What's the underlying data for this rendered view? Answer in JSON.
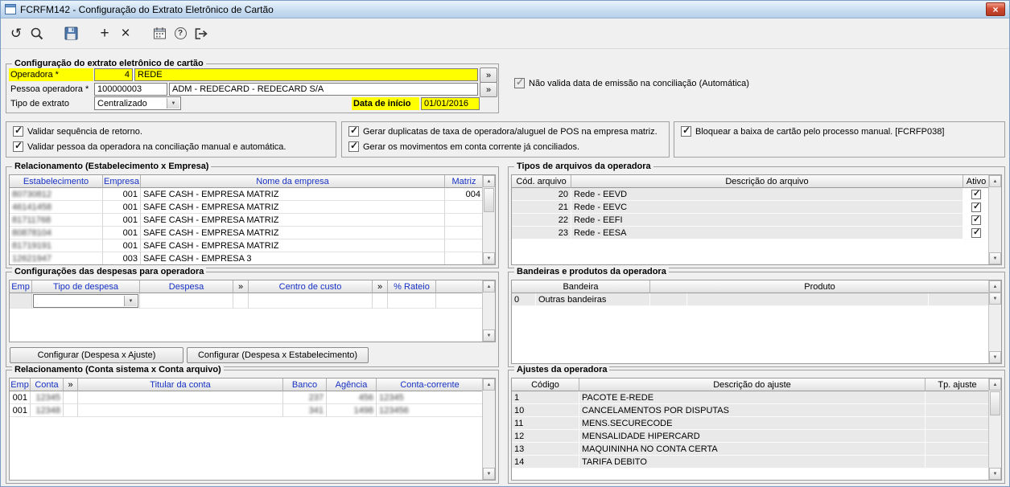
{
  "window": {
    "title": "FCRFM142 - Configuração do Extrato Eletrônico de Cartão",
    "close_label": "×"
  },
  "toolbar": {
    "icons": [
      "undo-icon",
      "search-icon",
      "save-icon",
      "add-icon",
      "delete-icon",
      "calendar-icon",
      "help-icon",
      "exit-icon"
    ]
  },
  "config": {
    "legend": "Configuração do extrato eletrônico de cartão",
    "operadora_label": "Operadora *",
    "operadora_code": "4",
    "operadora_name": "REDE",
    "pessoa_label": "Pessoa operadora *",
    "pessoa_code": "100000003",
    "pessoa_name": "ADM - REDECARD - REDECARD S/A",
    "tipo_label": "Tipo de extrato",
    "tipo_value": "Centralizado",
    "data_label": "Data de início",
    "data_value": "01/01/2016",
    "more_label": "»"
  },
  "flags": {
    "auto": {
      "label": "Não valida data de emissão na conciliação (Automática)",
      "checked": true
    },
    "g1": [
      {
        "label": "Validar sequência de retorno.",
        "checked": true
      },
      {
        "label": "Validar pessoa da operadora na conciliação manual e automática.",
        "checked": true
      }
    ],
    "g2": [
      {
        "label": "Gerar duplicatas de taxa de operadora/aluguel de POS na empresa matriz.",
        "checked": true
      },
      {
        "label": "Gerar os movimentos em conta corrente já conciliados.",
        "checked": true
      }
    ],
    "g3": [
      {
        "label": "Bloquear a baixa de cartão pelo processo manual. [FCRFP038]",
        "checked": true
      }
    ]
  },
  "estab": {
    "legend": "Relacionamento (Estabelecimento x Empresa)",
    "columns": [
      "Estabelecimento",
      "Empresa",
      "Nome da empresa",
      "Matriz"
    ],
    "rows": [
      {
        "estabelecimento": "80730812",
        "empresa": "001",
        "nome": "SAFE CASH - EMPRESA MATRIZ",
        "matriz": "004"
      },
      {
        "estabelecimento": "46141458",
        "empresa": "001",
        "nome": "SAFE CASH - EMPRESA MATRIZ",
        "matriz": ""
      },
      {
        "estabelecimento": "81711768",
        "empresa": "001",
        "nome": "SAFE CASH - EMPRESA MATRIZ",
        "matriz": ""
      },
      {
        "estabelecimento": "80878104",
        "empresa": "001",
        "nome": "SAFE CASH - EMPRESA MATRIZ",
        "matriz": ""
      },
      {
        "estabelecimento": "81719191",
        "empresa": "001",
        "nome": "SAFE CASH - EMPRESA MATRIZ",
        "matriz": ""
      },
      {
        "estabelecimento": "12621947",
        "empresa": "003",
        "nome": "SAFE CASH -  EMPRESA 3",
        "matriz": ""
      }
    ]
  },
  "despesas": {
    "legend": "Configurações das despesas para operadora",
    "columns": [
      "Emp",
      "Tipo de despesa",
      "Despesa",
      "»",
      "Centro de custo",
      "»",
      "% Rateio"
    ],
    "buttons": [
      "Configurar (Despesa x Ajuste)",
      "Configurar (Despesa x Estabelecimento)"
    ]
  },
  "contas": {
    "legend": "Relacionamento (Conta sistema x Conta arquivo)",
    "columns": [
      "Emp",
      "Conta",
      "»",
      "Titular da conta",
      "Banco",
      "Agência",
      "Conta-corrente"
    ],
    "rows": [
      {
        "emp": "001",
        "conta": "12345",
        "titular": "",
        "banco": "237",
        "agencia": "456",
        "cc": "12345"
      },
      {
        "emp": "001",
        "conta": "12348",
        "titular": "",
        "banco": "341",
        "agencia": "1498",
        "cc": "123456"
      }
    ]
  },
  "tipos": {
    "legend": "Tipos de arquivos da operadora",
    "columns": [
      "Cód. arquivo",
      "Descrição do arquivo",
      "Ativo"
    ],
    "rows": [
      {
        "codigo": "20",
        "descricao": "Rede - EEVD",
        "ativo": true
      },
      {
        "codigo": "21",
        "descricao": "Rede - EEVC",
        "ativo": true
      },
      {
        "codigo": "22",
        "descricao": "Rede - EEFI",
        "ativo": true
      },
      {
        "codigo": "23",
        "descricao": "Rede - EESA",
        "ativo": true
      }
    ]
  },
  "bandeiras": {
    "legend": "Bandeiras e produtos da operadora",
    "columns": [
      "Bandeira",
      "Produto"
    ],
    "rows": [
      {
        "codigo": "0",
        "bandeira": "Outras bandeiras",
        "produto": ""
      }
    ]
  },
  "ajustes": {
    "legend": "Ajustes da operadora",
    "columns": [
      "Código",
      "Descrição do ajuste",
      "Tp. ajuste"
    ],
    "rows": [
      {
        "codigo": "1",
        "descricao": "PACOTE E-REDE",
        "tp": ""
      },
      {
        "codigo": "10",
        "descricao": "CANCELAMENTOS POR DISPUTAS",
        "tp": ""
      },
      {
        "codigo": "11",
        "descricao": "MENS.SECURECODE",
        "tp": ""
      },
      {
        "codigo": "12",
        "descricao": "MENSALIDADE HIPERCARD",
        "tp": ""
      },
      {
        "codigo": "13",
        "descricao": "MAQUININHA NO CONTA CERTA",
        "tp": ""
      },
      {
        "codigo": "14",
        "descricao": "TARIFA DEBITO",
        "tp": ""
      }
    ]
  }
}
